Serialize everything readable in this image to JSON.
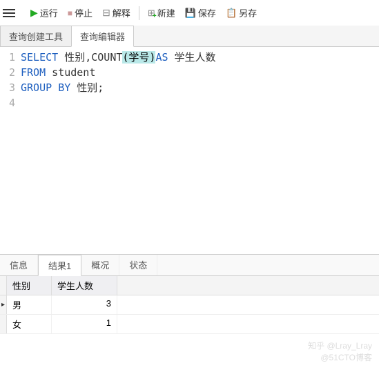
{
  "toolbar": {
    "run": "运行",
    "stop": "停止",
    "explain": "解释",
    "new": "新建",
    "save": "保存",
    "saveas": "另存"
  },
  "top_tabs": [
    {
      "label": "查询创建工具",
      "active": false
    },
    {
      "label": "查询编辑器",
      "active": true
    }
  ],
  "editor": {
    "lines": [
      "1",
      "2",
      "3",
      "4"
    ],
    "tokens": {
      "l1_select": "SELECT",
      "l1_mid": " 性别,COUNT",
      "l1_paren": "(学号)",
      "l1_as": "AS",
      "l1_end": " 学生人数",
      "l2_from": "FROM",
      "l2_tbl": " student",
      "l3_group": "GROUP",
      "l3_by": "BY",
      "l3_col": " 性别;"
    }
  },
  "bottom_tabs": [
    {
      "label": "信息",
      "active": false
    },
    {
      "label": "结果1",
      "active": true
    },
    {
      "label": "概况",
      "active": false
    },
    {
      "label": "状态",
      "active": false
    }
  ],
  "result": {
    "columns": [
      "性别",
      "学生人数"
    ],
    "rows": [
      {
        "marker": "▸",
        "c0": "男",
        "c1": "3"
      },
      {
        "marker": "",
        "c0": "女",
        "c1": "1"
      }
    ]
  },
  "watermark": {
    "l1": "知乎 @Lray_Lray",
    "l2": "@51CTO博客"
  }
}
